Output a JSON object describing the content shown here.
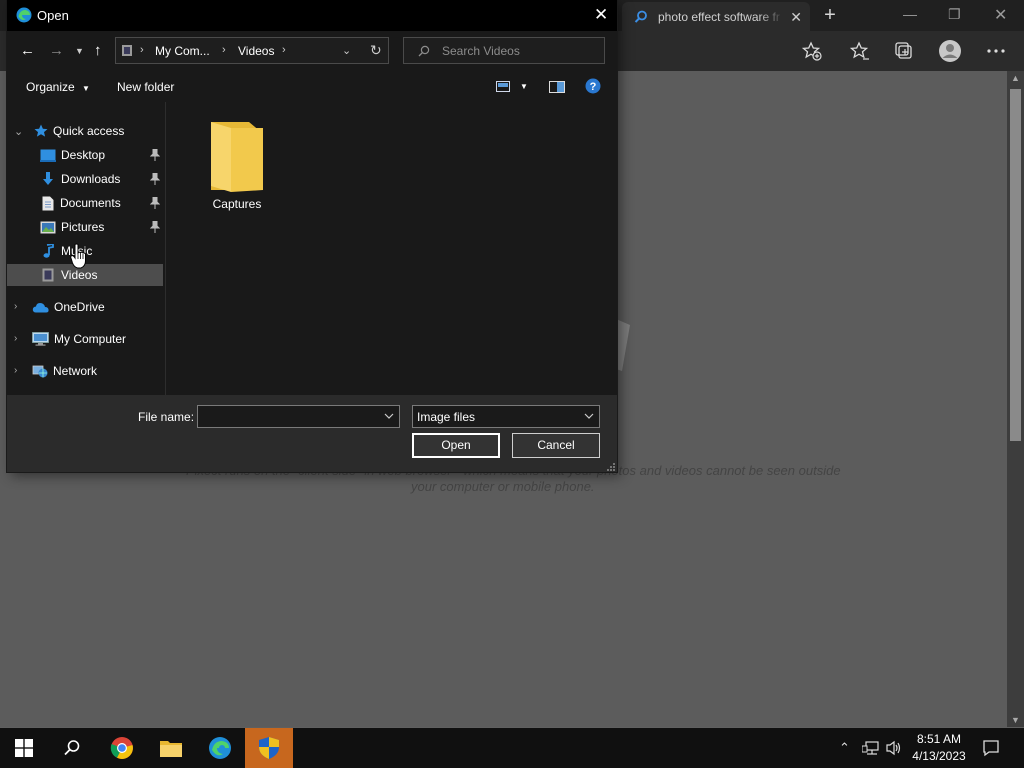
{
  "browser": {
    "tab_title": "photo effect software fr",
    "page_text_line1": "Pixect runs on the \"client side\" in web browser - which means that your photos and videos cannot be seen outside",
    "page_text_line2": "your computer or mobile phone."
  },
  "dialog": {
    "title": "Open",
    "address": {
      "crumb1": "My Com...",
      "crumb2": "Videos"
    },
    "search_placeholder": "Search Videos",
    "toolbar": {
      "organize": "Organize",
      "new_folder": "New folder"
    },
    "nav": {
      "quick_access": "Quick access",
      "desktop": "Desktop",
      "downloads": "Downloads",
      "documents": "Documents",
      "pictures": "Pictures",
      "music": "Music",
      "videos": "Videos",
      "onedrive": "OneDrive",
      "my_computer": "My Computer",
      "network": "Network"
    },
    "items": [
      {
        "name": "Captures",
        "type": "folder"
      }
    ],
    "file_name_label": "File name:",
    "file_name_value": "",
    "file_type": "Image files",
    "open_button": "Open",
    "cancel_button": "Cancel"
  },
  "taskbar": {
    "time": "8:51 AM",
    "date": "4/13/2023"
  },
  "colors": {
    "accent_blue": "#0f9fe0",
    "folder_yellow": "#f2c94c",
    "taskbar_active": "#c7671e"
  }
}
